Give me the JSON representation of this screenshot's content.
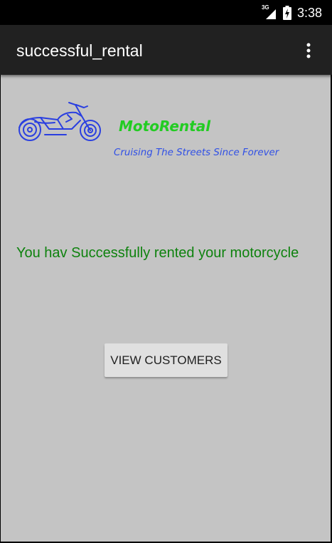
{
  "status_bar": {
    "network_type": "3G",
    "time": "3:38",
    "icons": [
      "signal-icon",
      "battery-charging-icon"
    ]
  },
  "action_bar": {
    "title": "successful_rental",
    "overflow_icon": "more-vert-icon"
  },
  "logo": {
    "icon": "motorcycle-icon",
    "brand_name": "MotoRental",
    "tagline": "Cruising The Streets Since Forever"
  },
  "main": {
    "message": "You hav Successfully rented your motorcycle",
    "view_customers_label": "VIEW CUSTOMERS"
  },
  "colors": {
    "action_bar": "#212121",
    "background": "#c4c4c4",
    "brand": "#22cc22",
    "tagline": "#3050e6",
    "message": "#0e820e",
    "button": "#e0e0e0"
  }
}
